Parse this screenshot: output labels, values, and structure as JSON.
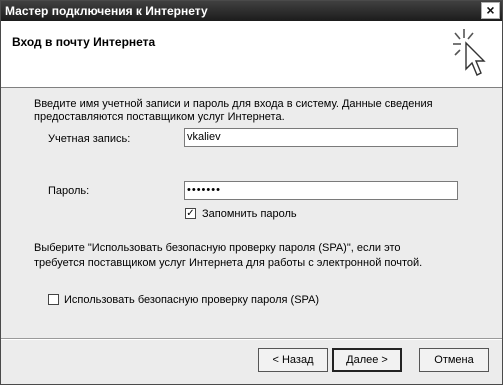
{
  "window": {
    "title": "Мастер подключения к Интернету",
    "close_label": "×"
  },
  "header": {
    "title": "Вход в почту Интернета",
    "icon": "wizard-cursor-icon"
  },
  "intro_line1": "Введите имя учетной записи и пароль для входа в систему. Данные сведения",
  "intro_line2": "предоставляются поставщиком услуг Интернета.",
  "account": {
    "label": "Учетная запись:",
    "value": "vkaliev"
  },
  "password": {
    "label": "Пароль:",
    "value": "•••••••"
  },
  "remember": {
    "label": "Запомнить пароль",
    "checked": true,
    "mark": "✓"
  },
  "spa_note_line1": "Выберите \"Использовать безопасную проверку пароля (SPA)\", если это",
  "spa_note_line2": "требуется поставщиком услуг Интернета для работы с электронной почтой.",
  "spa": {
    "label": "Использовать безопасную проверку пароля (SPA)",
    "checked": false
  },
  "buttons": {
    "back": "< Назад",
    "next": "Далее >",
    "cancel": "Отмена"
  }
}
